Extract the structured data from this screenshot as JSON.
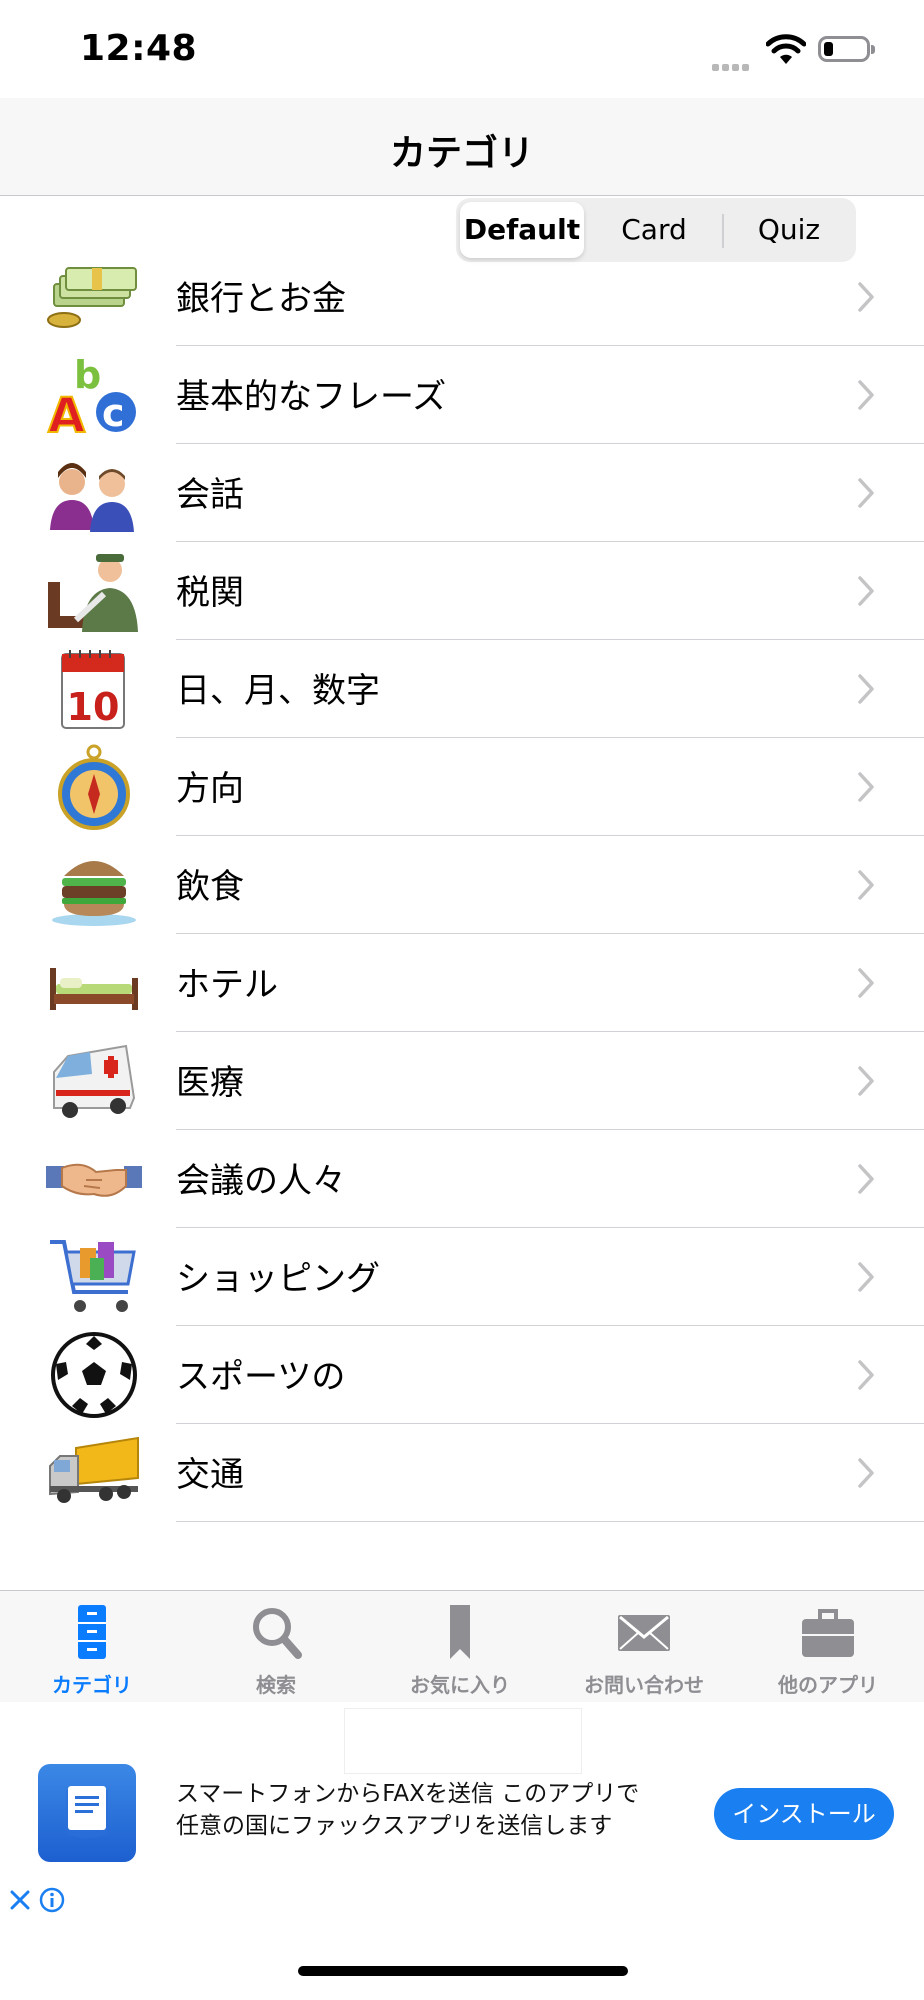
{
  "status_bar": {
    "time": "12:48"
  },
  "nav": {
    "title": "カテゴリ"
  },
  "segmented": {
    "options": [
      "Default",
      "Card",
      "Quiz"
    ],
    "selected": "Default"
  },
  "categories": [
    {
      "label": "銀行とお金",
      "icon": "money-icon"
    },
    {
      "label": "基本的なフレーズ",
      "icon": "abc-icon"
    },
    {
      "label": "会話",
      "icon": "people-icon"
    },
    {
      "label": "税関",
      "icon": "customs-officer-icon"
    },
    {
      "label": "日、月、数字",
      "icon": "calendar-icon"
    },
    {
      "label": "方向",
      "icon": "compass-icon"
    },
    {
      "label": "飲食",
      "icon": "burger-icon"
    },
    {
      "label": "ホテル",
      "icon": "bed-icon"
    },
    {
      "label": "医療",
      "icon": "ambulance-icon"
    },
    {
      "label": "会議の人々",
      "icon": "handshake-icon"
    },
    {
      "label": "ショッピング",
      "icon": "shopping-cart-icon"
    },
    {
      "label": "スポーツの",
      "icon": "soccer-ball-icon"
    },
    {
      "label": "交通",
      "icon": "truck-icon"
    }
  ],
  "tabs": [
    {
      "label": "カテゴリ",
      "icon": "cabinet-icon",
      "active": true
    },
    {
      "label": "検索",
      "icon": "search-icon",
      "active": false
    },
    {
      "label": "お気に入り",
      "icon": "bookmark-icon",
      "active": false
    },
    {
      "label": "お問い合わせ",
      "icon": "mail-icon",
      "active": false
    },
    {
      "label": "他のアプリ",
      "icon": "briefcase-icon",
      "active": false
    }
  ],
  "ad": {
    "line1": "スマートフォンからFAXを送信 このアプリで",
    "line2": "任意の国にファックスアプリを送信します",
    "install_label": "インストール"
  },
  "colors": {
    "accent": "#0a7cff",
    "inactive_tab": "#8e8e93",
    "install_button": "#1a7ff0"
  }
}
